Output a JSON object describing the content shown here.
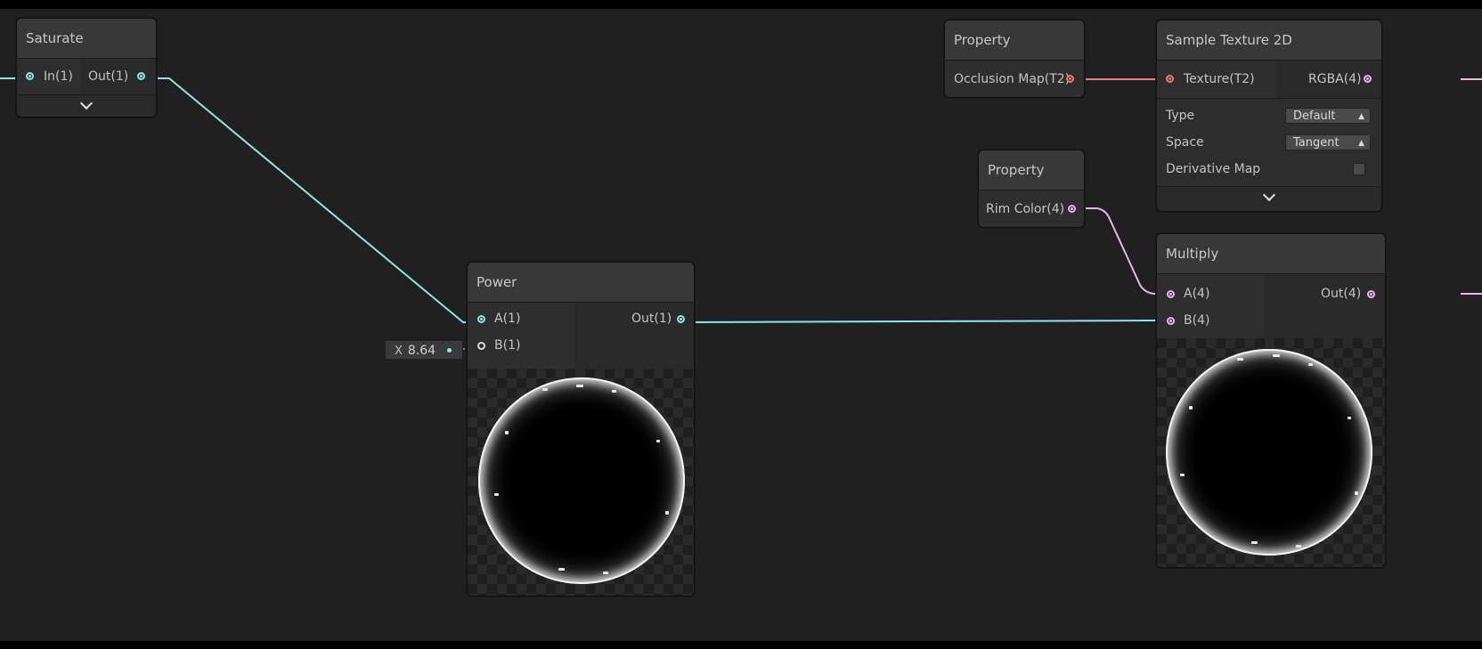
{
  "app": "Shader Graph",
  "nodes": {
    "saturate": {
      "title": "Saturate",
      "input": "In(1)",
      "output": "Out(1)"
    },
    "property_occlusion": {
      "title": "Property",
      "output": "Occlusion Map(T2)"
    },
    "sample_texture": {
      "title": "Sample Texture 2D",
      "input": "Texture(T2)",
      "output": "RGBA(4)",
      "settings": {
        "type_label": "Type",
        "type_value": "Default",
        "space_label": "Space",
        "space_value": "Tangent",
        "derivative_label": "Derivative Map"
      }
    },
    "property_rim": {
      "title": "Property",
      "output": "Rim Color(4)"
    },
    "power": {
      "title": "Power",
      "input_a": "A(1)",
      "input_b": "B(1)",
      "output": "Out(1)",
      "inline_b_axis": "X",
      "inline_b_value": "8.64"
    },
    "multiply": {
      "title": "Multiply",
      "input_a": "A(4)",
      "input_b": "B(4)",
      "output": "Out(4)"
    }
  },
  "colors": {
    "canvas": "#202020",
    "wire_float": "#8de8e4",
    "wire_texture": "#f07a7a",
    "wire_vector4": "#eab4ee"
  },
  "icons": [
    "port-dot-icon",
    "chevron-down-icon",
    "dropdown-arrows-icon",
    "checkbox-icon"
  ]
}
